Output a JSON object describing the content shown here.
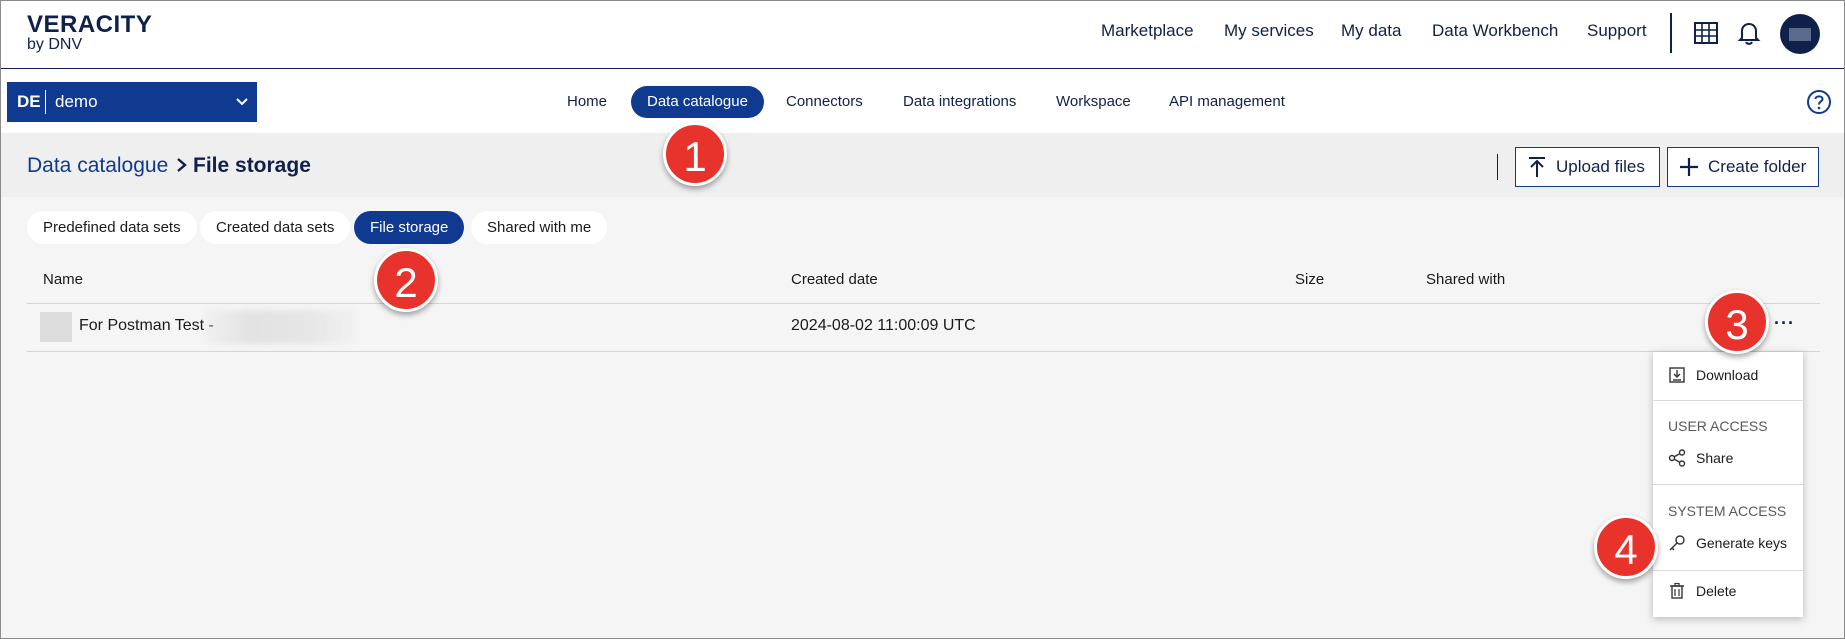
{
  "logo": {
    "main": "VERACITY",
    "sub": "by DNV"
  },
  "topnav": [
    "Marketplace",
    "My services",
    "My data",
    "Data Workbench",
    "Support"
  ],
  "tenant": {
    "code": "DE",
    "name": "demo"
  },
  "tabs": [
    "Home",
    "Data catalogue",
    "Connectors",
    "Data integrations",
    "Workspace",
    "API management"
  ],
  "active_tab": "Data catalogue",
  "breadcrumb": {
    "parent": "Data catalogue",
    "current": "File storage"
  },
  "actions": {
    "upload": "Upload files",
    "create_folder": "Create folder"
  },
  "pills": [
    "Predefined data sets",
    "Created data sets",
    "File storage",
    "Shared with me"
  ],
  "table": {
    "columns": [
      "Name",
      "Created date",
      "Size",
      "Shared with"
    ],
    "rows": [
      {
        "name": "For Postman Test -",
        "created": "2024-08-02 11:00:09 UTC",
        "size": "",
        "shared_with": ""
      }
    ]
  },
  "menu": {
    "download": "Download",
    "user_access": "USER ACCESS",
    "share": "Share",
    "system_access": "SYSTEM ACCESS",
    "generate_keys": "Generate keys",
    "delete": "Delete"
  },
  "badges": [
    "1",
    "2",
    "3",
    "4"
  ],
  "colors": {
    "brand_navy": "#0f204b",
    "accent_blue": "#0f3a8f",
    "badge_red": "#e8332c"
  }
}
